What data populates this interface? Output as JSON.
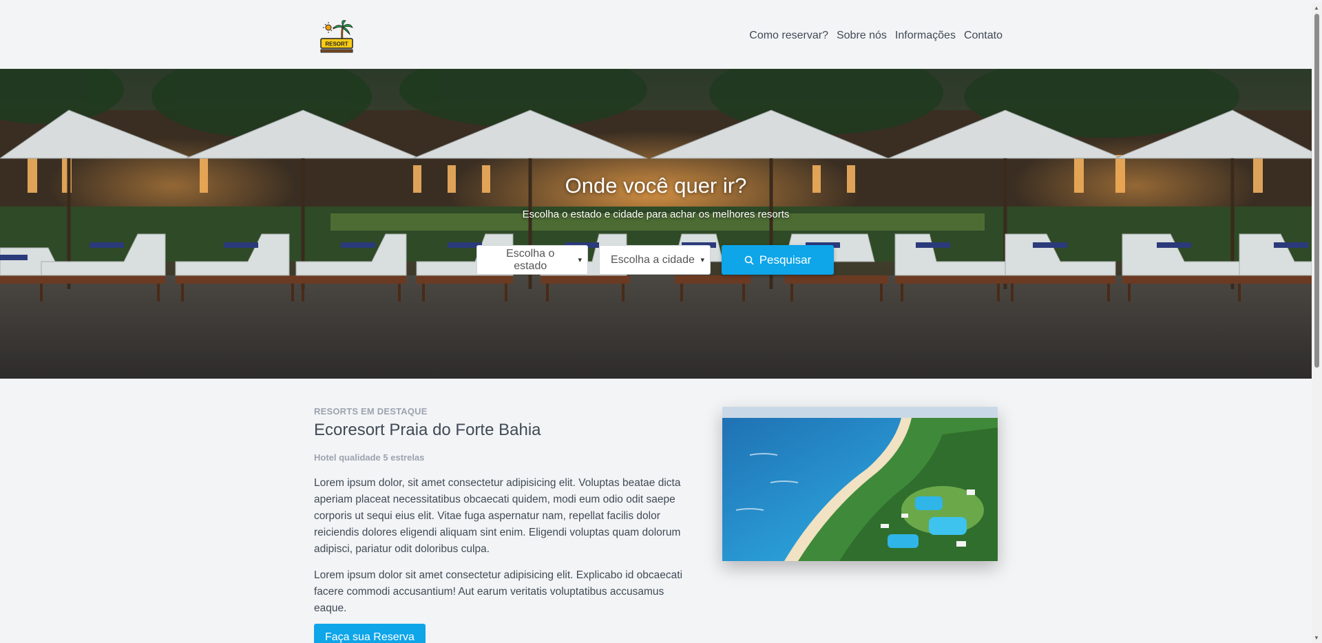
{
  "header": {
    "logo_text": "RESORT",
    "nav": [
      "Como reservar?",
      "Sobre nós",
      "Informações",
      "Contato"
    ]
  },
  "hero": {
    "title": "Onde você quer ir?",
    "subtitle": "Escolha o estado e cidade para achar os melhores resorts",
    "state_select": "Escolha o estado",
    "city_select": "Escolha a cidade",
    "search_button": "Pesquisar"
  },
  "featured": {
    "eyebrow": "RESORTS EM DESTAQUE",
    "title": "Ecoresort Praia do Forte Bahia",
    "subtitle": "Hotel qualidade 5 estrelas",
    "paragraph_1": "Lorem ipsum dolor, sit amet consectetur adipisicing elit. Voluptas beatae dicta aperiam placeat necessitatibus obcaecati quidem, modi eum odio odit saepe corporis ut sequi eius elit. Vitae fuga aspernatur nam, repellat facilis dolor reiciendis dolores eligendi aliquam sint enim. Eligendi voluptas quam dolorum adipisci, pariatur odit doloribus culpa.",
    "paragraph_2": "Lorem ipsum dolor sit amet consectetur adipisicing elit. Explicabo id obcaecati facere commodi accusantium! Aut earum veritatis voluptatibus accusamus eaque.",
    "reserve_button": "Faça sua Reserva"
  },
  "colors": {
    "accent": "#0ea5e9",
    "page_bg": "#f3f4f6",
    "text": "#3f4a55",
    "muted": "#9ca3af"
  },
  "icons": {
    "logo": "palm-tree-resort-sign",
    "search": "magnifier-icon",
    "select_arrow": "chevron-down-icon"
  }
}
